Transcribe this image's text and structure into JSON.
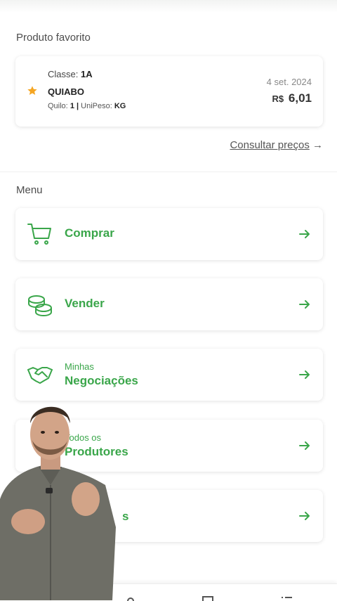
{
  "favorite": {
    "section_title": "Produto favorito",
    "class_label": "Classe:",
    "class_value": "1A",
    "product_name": "QUIABO",
    "unit_label": "Quilo:",
    "unit_value": "1",
    "separator": "|",
    "unipeso_label": "UniPeso:",
    "unipeso_value": "KG",
    "date": "4 set. 2024",
    "currency": "R$",
    "price": "6,01",
    "star_icon": "star-icon",
    "star_color": "#f5a623"
  },
  "consult_link": {
    "label": "Consultar preços",
    "arrow": "→"
  },
  "menu": {
    "section_title": "Menu",
    "accent_color": "#3aa64a",
    "items": [
      {
        "icon": "cart-icon",
        "label": "Comprar"
      },
      {
        "icon": "coins-icon",
        "label": "Vender"
      },
      {
        "icon": "handshake-icon",
        "small": "Minhas",
        "label": "Negociações"
      },
      {
        "icon": "producers-icon",
        "small": "Todos os",
        "label": "Produtores"
      },
      {
        "icon": "menu-item-icon",
        "label": "s"
      }
    ]
  },
  "bottom_nav": {
    "icons": [
      "home-icon",
      "profile-icon",
      "cart-icon",
      "list-icon"
    ]
  }
}
